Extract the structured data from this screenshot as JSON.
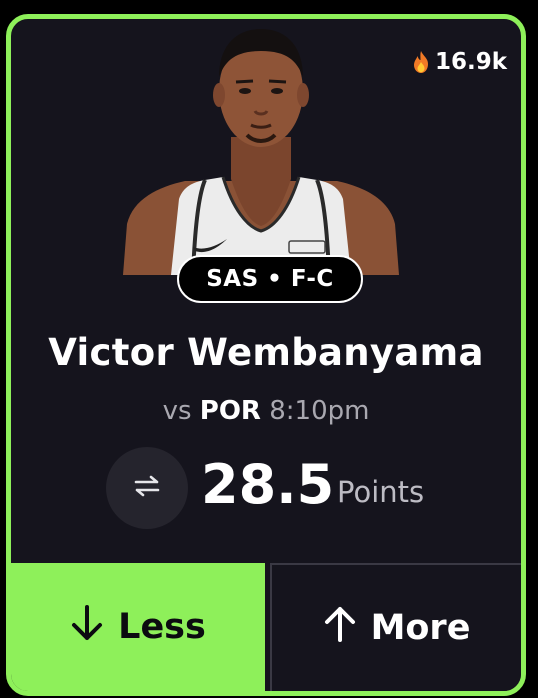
{
  "card": {
    "accent_color": "#8ef05a",
    "popularity": {
      "icon": "flame-icon",
      "count": "16.9k"
    },
    "player": {
      "photo": "player-headshot",
      "team_position": "SAS • F-C",
      "name": "Victor Wembanyama"
    },
    "matchup": {
      "prefix": "vs",
      "opponent": "POR",
      "time": "8:10pm"
    },
    "projection": {
      "swap_icon": "swap-arrows-icon",
      "value": "28.5",
      "stat": "Points"
    },
    "actions": {
      "less_icon": "arrow-down-icon",
      "less_label": "Less",
      "more_icon": "arrow-up-icon",
      "more_label": "More"
    }
  }
}
